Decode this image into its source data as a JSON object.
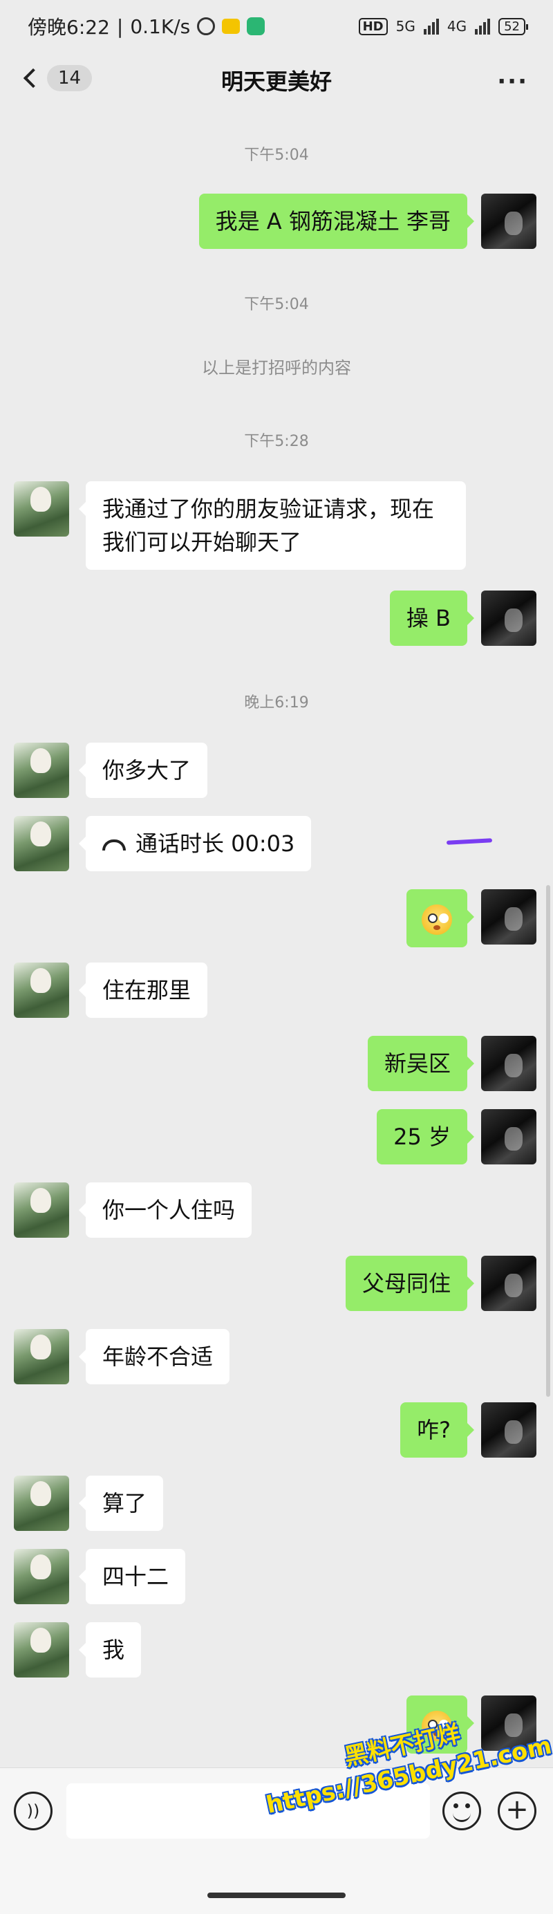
{
  "status_bar": {
    "time": "傍晚6:22",
    "net_speed": "0.1K/s",
    "hd": "HD",
    "sig1_label": "5G",
    "sig2_label": "4G",
    "battery": "52"
  },
  "nav": {
    "unread": "14",
    "title": "明天更美好",
    "more": "···"
  },
  "chat": {
    "t1": "下午5:04",
    "m1": "我是 A 钢筋混凝土 李哥",
    "t2": "下午5:04",
    "sys1": "以上是打招呼的内容",
    "t3": "下午5:28",
    "m2": "我通过了你的朋友验证请求，现在我们可以开始聊天了",
    "m3": "操 B",
    "t4": "晚上6:19",
    "m4": "你多大了",
    "m5": "通话时长 00:03",
    "m6_emoji": "flushed-face",
    "m7": "住在那里",
    "m8": "新吴区",
    "m9": "25 岁",
    "m10": "你一个人住吗",
    "m11": "父母同住",
    "m12": "年龄不合适",
    "m13": "咋?",
    "m14": "算了",
    "m15": "四十二",
    "m16": "我",
    "m17_emoji": "flushed-face"
  },
  "input_bar": {
    "voice_icon": "voice-icon",
    "emoji_icon": "emoji-icon",
    "plus": "+"
  },
  "watermark": {
    "line1": "黑料不打烊",
    "line2": "https://365bdy21.com"
  },
  "colors": {
    "bubble_self": "#95ec69",
    "bubble_other": "#ffffff",
    "background": "#ececec"
  }
}
